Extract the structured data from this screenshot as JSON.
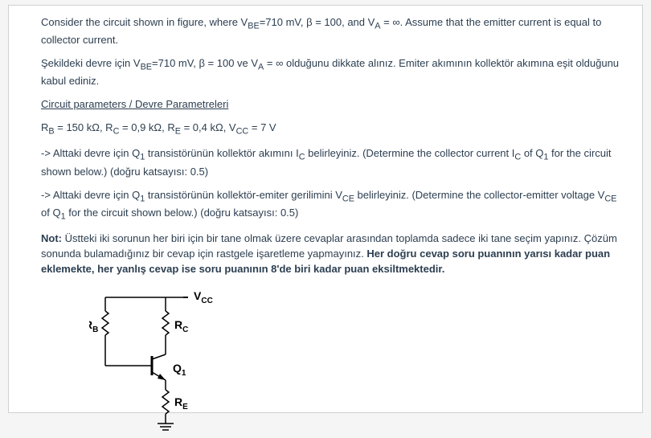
{
  "p1": "Consider the circuit shown in figure, where V",
  "p1_sub1": "BE",
  "p1_b": "=710 mV, β = 100, and V",
  "p1_sub2": "A",
  "p1_c": " = ∞. Assume that the emitter current is equal to collector current.",
  "p2a": "Şekildeki devre için V",
  "p2a_sub": "BE",
  "p2b": "=710 mV, β = 100 ve V",
  "p2b_sub": "A",
  "p2c": " = ∞ olduğunu dikkate alınız. Emiter akımının kollektör akımına eşit olduğunu kabul ediniz.",
  "p3": "Circuit parameters / Devre Parametreleri",
  "p4a": "R",
  "p4a_sub": "B",
  "p4b": " = 150 kΩ, R",
  "p4b_sub": "C",
  "p4c": " = 0,9 kΩ, R",
  "p4c_sub": "E",
  "p4d": " = 0,4 kΩ, V",
  "p4d_sub": "CC",
  "p4e": " = 7 V",
  "p5a": "-> Alttaki devre için Q",
  "p5a_sub": "1",
  "p5b": " transistörünün kollektör akımını I",
  "p5b_sub": "C",
  "p5c": " belirleyiniz. (Determine the collector current I",
  "p5c_sub": "C",
  "p5d": " of Q",
  "p5d_sub": "1",
  "p5e": " for the circuit shown below.) (doğru katsayısı: 0.5)",
  "p6a": "-> Alttaki devre için Q",
  "p6a_sub": "1",
  "p6b": " transistörünün kollektör-emiter gerilimini V",
  "p6b_sub": "CE",
  "p6c": " belirleyiniz. (Determine the collector-emitter voltage V",
  "p6c_sub": "CE",
  "p6d": " of Q",
  "p6d_sub": "1",
  "p6e": " for the circuit shown below.) (doğru katsayısı: 0.5)",
  "p7a": "Not:",
  "p7b": " Üstteki iki sorunun her biri için bir tane olmak üzere cevaplar arasından toplamda sadece iki tane seçim yapınız. Çözüm sonunda bulamadığınız bir cevap için rastgele işaretleme yapmayınız. ",
  "p7c": "Her doğru cevap soru puanının yarısı kadar puan eklemekte, her yanlış cevap ise soru puanının 8'de biri kadar puan eksiltmektedir.",
  "circuit_labels": {
    "vcc": "V",
    "vcc_sub": "CC",
    "rb": "R",
    "rb_sub": "B",
    "rc": "R",
    "rc_sub": "C",
    "q1": "Q",
    "q1_sub": "1",
    "re": "R",
    "re_sub": "E"
  }
}
